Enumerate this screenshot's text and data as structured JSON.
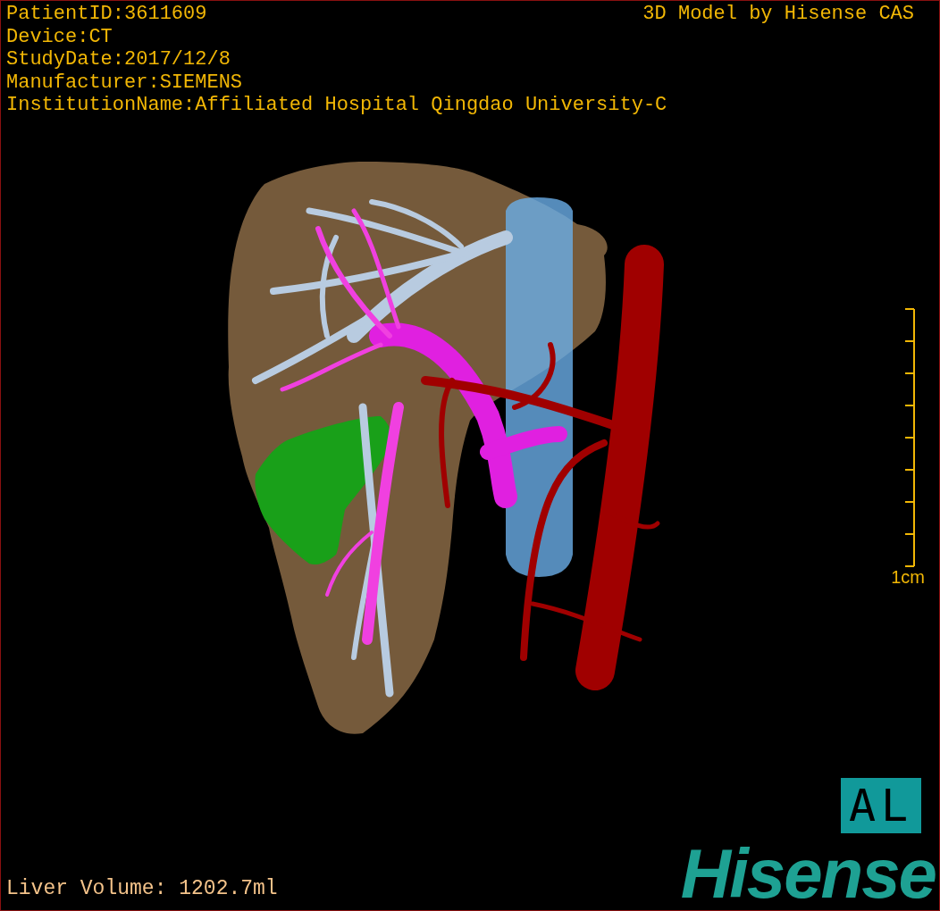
{
  "patient_info": [
    "PatientID:3611609",
    "Device:CT",
    "StudyDate:2017/12/8",
    "Manufacturer:SIEMENS",
    "InstitutionName:Affiliated Hospital Qingdao University-C"
  ],
  "model_title": "3D Model by Hisense CAS",
  "scale_bar": {
    "label": "1cm"
  },
  "orientation_label": "AL",
  "liver_volume": "Liver Volume: 1202.7ml",
  "logo": "Hisense"
}
